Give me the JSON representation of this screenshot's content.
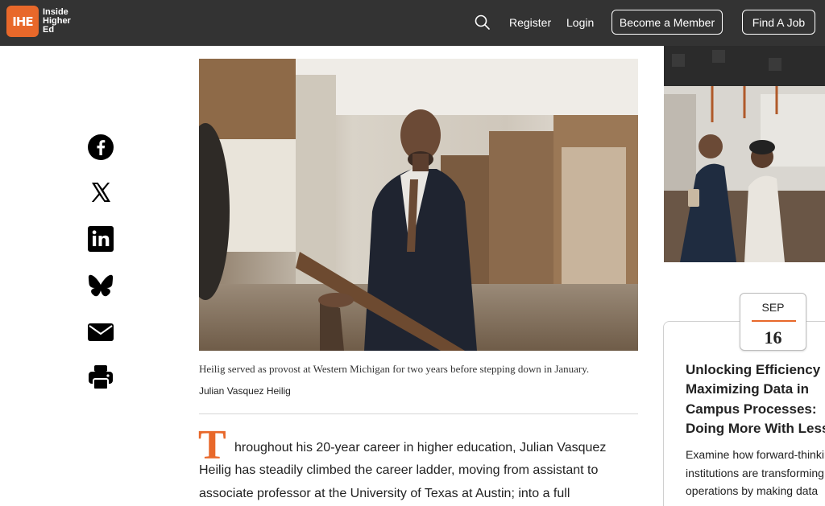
{
  "header": {
    "logo_mark": "IHE",
    "logo_line1": "Inside",
    "logo_line2": "Higher",
    "logo_line3": "Ed",
    "register_label": "Register",
    "login_label": "Login",
    "member_label": "Become a Member",
    "job_label": "Find A Job"
  },
  "share": {
    "icons": [
      "facebook-icon",
      "x-icon",
      "linkedin-icon",
      "bluesky-icon",
      "email-icon",
      "print-icon"
    ]
  },
  "article": {
    "caption": "Heilig served as provost at Western Michigan for two years before stepping down in January.",
    "credit": "Julian Vasquez Heilig",
    "dropcap": "T",
    "lines": [
      "hroughout his 20-year career in higher education, Julian Vasquez",
      "Heilig has steadily climbed the career ladder, moving from assistant to",
      "associate professor at the University of Texas at Austin; into a full"
    ]
  },
  "sidebar": {
    "event": {
      "month": "SEP",
      "day": "16",
      "title_lines": [
        "Unlocking Efficiency",
        "Maximizing Data in",
        "Campus Processes:",
        "Doing More With Less"
      ],
      "desc_lines": [
        "Examine how forward-thinking",
        "institutions are transforming",
        "operations by making data"
      ]
    }
  },
  "colors": {
    "header_bg": "#333333",
    "accent": "#e8682a"
  }
}
